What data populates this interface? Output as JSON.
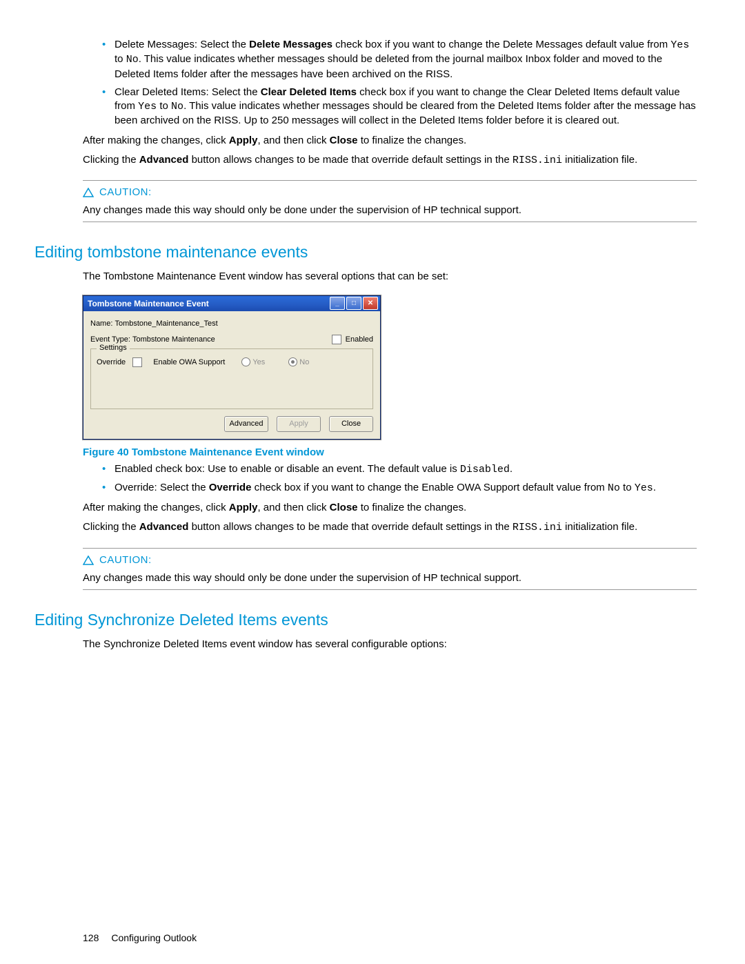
{
  "bullets1": {
    "b1_pre": "Delete Messages:  Select the ",
    "b1_bold": "Delete Messages",
    "b1_mid1": " check box if you want to change the Delete Messages default value from ",
    "b1_yes": "Yes",
    "b1_to": " to ",
    "b1_no": "No",
    "b1_post": ".  This value indicates whether messages should be deleted from the journal mailbox Inbox folder and moved to the Deleted Items folder after the messages have been archived on the RISS.",
    "b2_pre": "Clear Deleted Items:  Select the ",
    "b2_bold": "Clear Deleted Items",
    "b2_mid1": " check box if you want to change the Clear Deleted Items default value from ",
    "b2_yes": "Yes",
    "b2_to": " to ",
    "b2_no": "No",
    "b2_post": ".  This value indicates whether messages should be cleared from the Deleted Items folder after the message has been archived on the RISS. Up to 250 messages will collect in the Deleted Items folder before it is cleared out."
  },
  "para1": {
    "pre": "After making the changes, click ",
    "apply": "Apply",
    "mid": ", and then click ",
    "close": "Close",
    "post": " to finalize the changes."
  },
  "para2": {
    "pre": "Clicking the ",
    "adv": "Advanced",
    "mid": " button allows changes to be made that override default settings in the ",
    "file": "RISS.ini",
    "post": " initialization file."
  },
  "caution": {
    "label": "CAUTION:",
    "body": "Any changes made this way should only be done under the supervision of HP technical support."
  },
  "section1": {
    "heading": "Editing tombstone maintenance events",
    "intro": "The Tombstone Maintenance Event window has several options that can be set:"
  },
  "dialog": {
    "title": "Tombstone Maintenance Event",
    "name_label": "Name:",
    "name_value": "Tombstone_Maintenance_Test",
    "type_label": "Event Type:",
    "type_value": "Tombstone Maintenance",
    "enabled": "Enabled",
    "settings": "Settings",
    "override": "Override",
    "owa": "Enable OWA Support",
    "yes": "Yes",
    "no": "No",
    "btn_adv": "Advanced",
    "btn_apply": "Apply",
    "btn_close": "Close"
  },
  "figcaption": "Figure 40 Tombstone Maintenance Event window",
  "bullets2": {
    "b1_pre": "Enabled check box:  Use to enable or disable an event.  The default value is ",
    "b1_val": "Disabled",
    "b1_post": ".",
    "b2_pre": "Override:  Select the ",
    "b2_bold": "Override",
    "b2_mid": " check box if you want to change the Enable OWA Support default value from ",
    "b2_no": "No",
    "b2_to": " to ",
    "b2_yes": "Yes",
    "b2_post": "."
  },
  "section2": {
    "heading": "Editing Synchronize Deleted Items events",
    "intro": "The Synchronize Deleted Items event window has several configurable options:"
  },
  "footer": {
    "page": "128",
    "section": "Configuring Outlook"
  }
}
